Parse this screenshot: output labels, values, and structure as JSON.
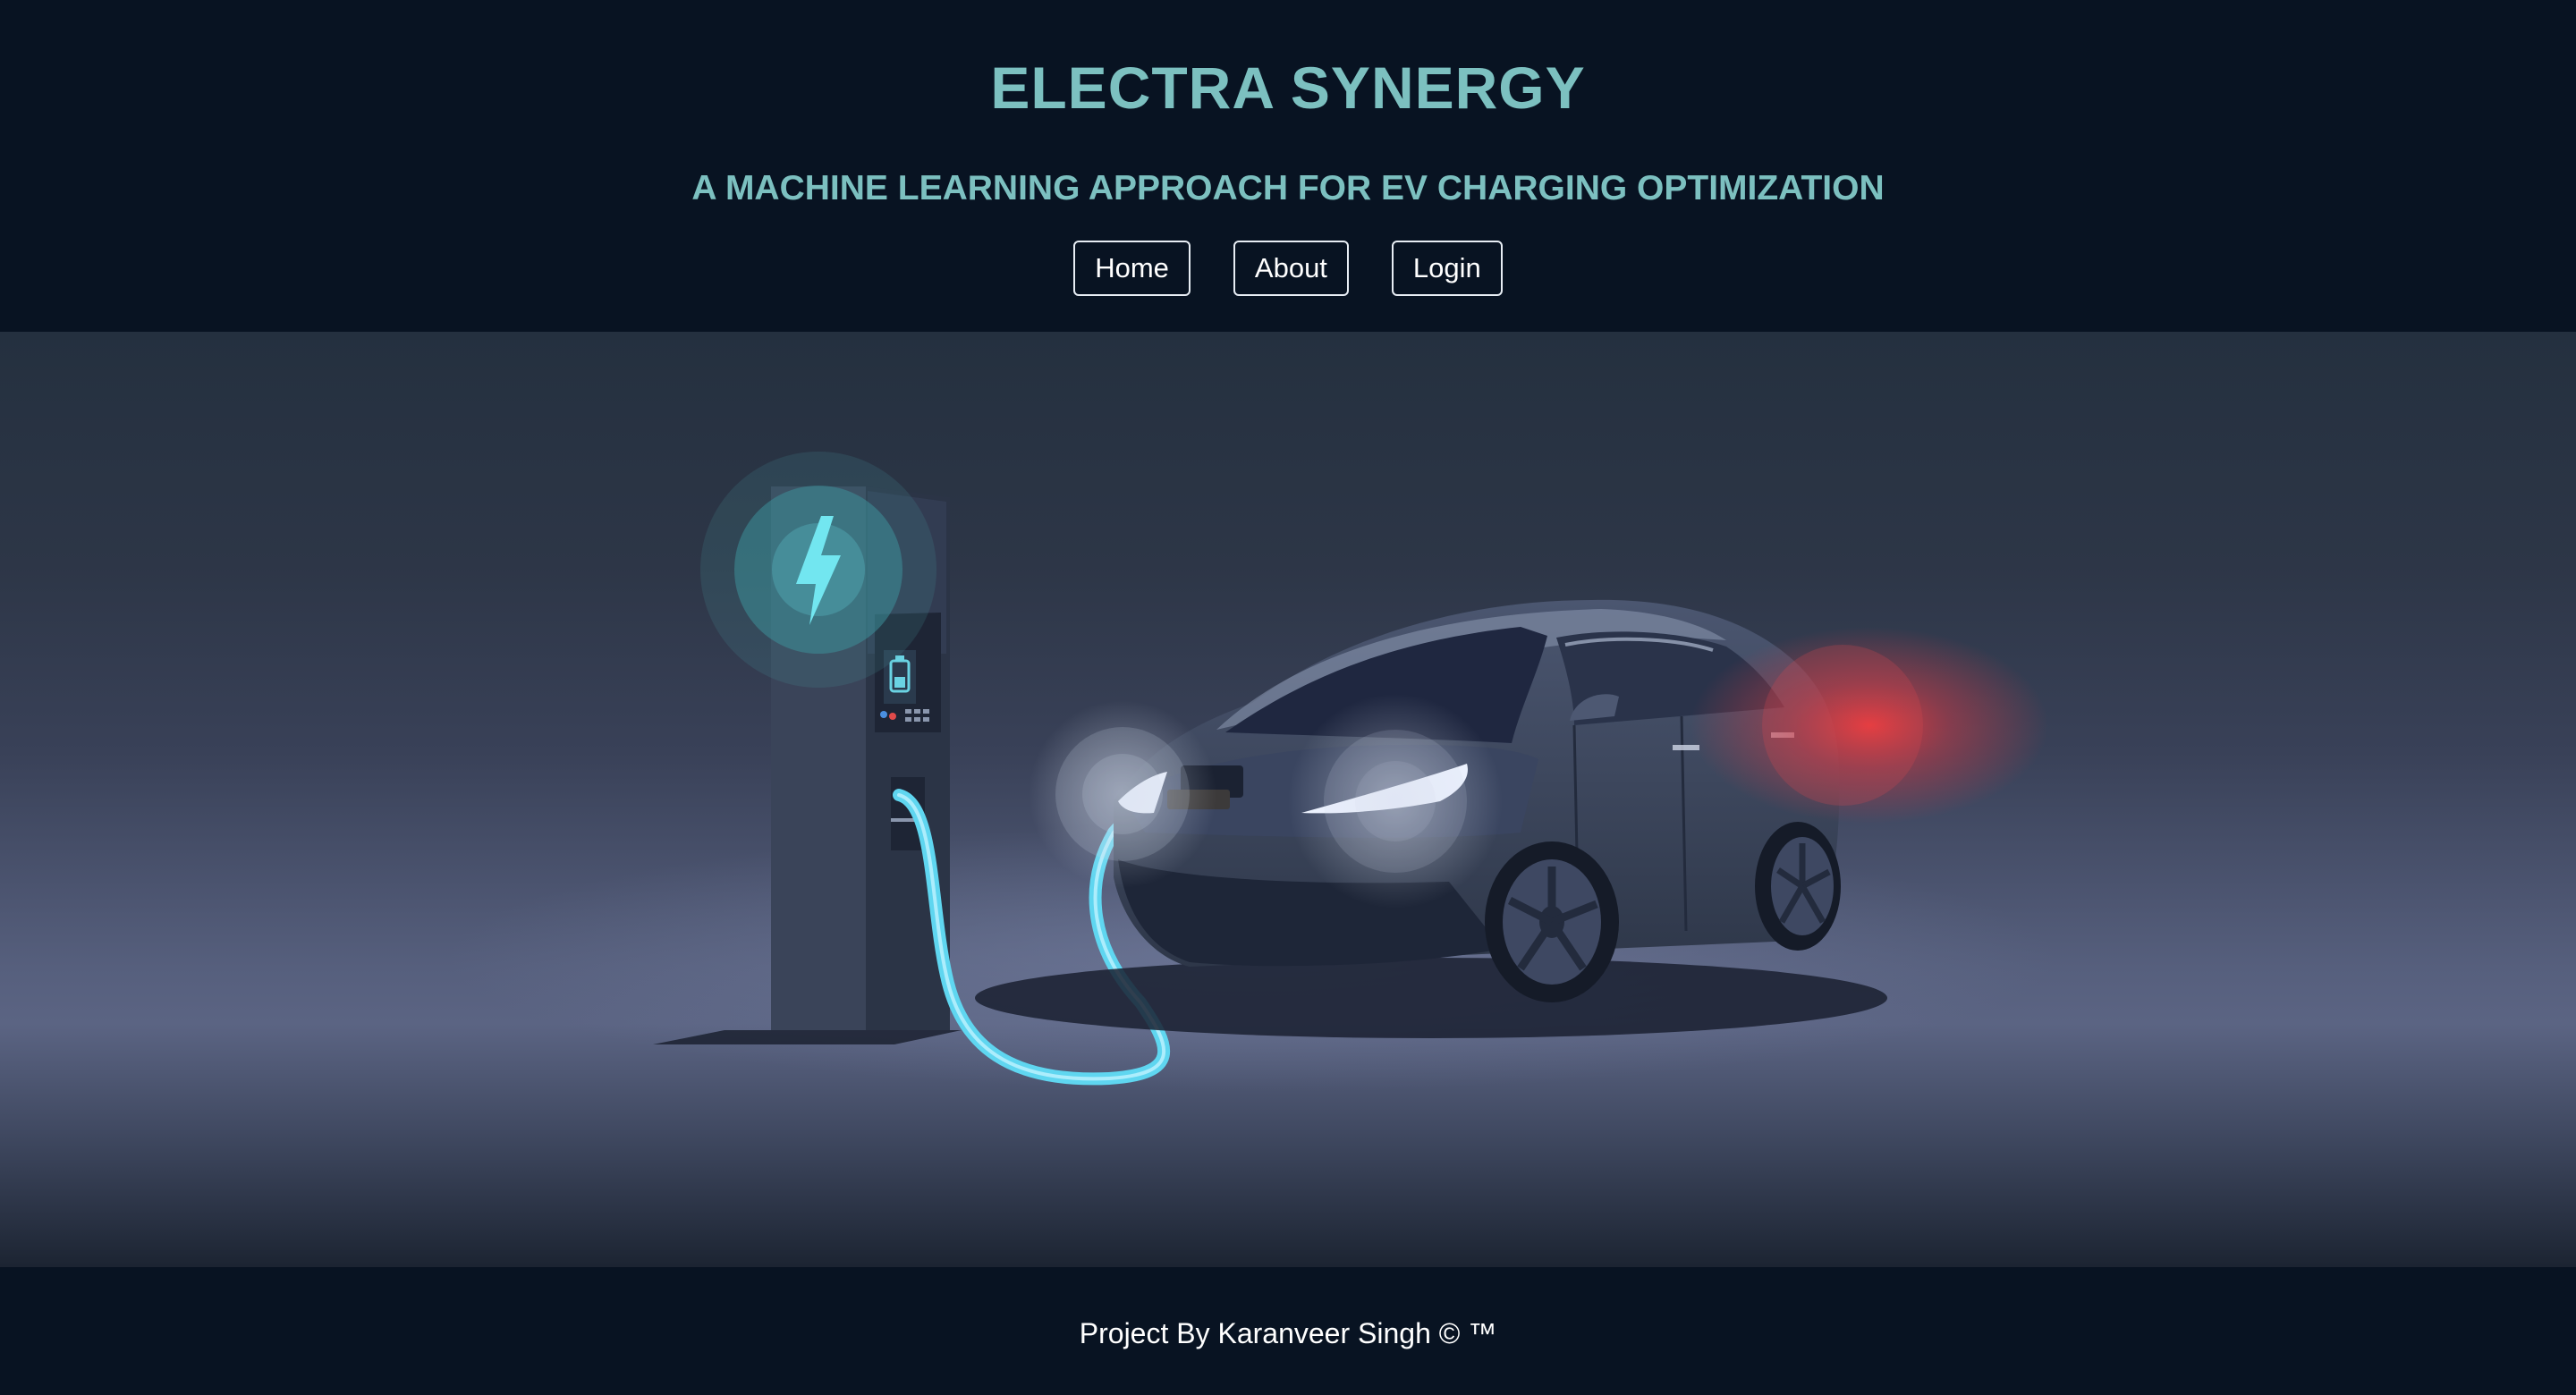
{
  "header": {
    "title": "ELECTRA SYNERGY",
    "subtitle": "A MACHINE LEARNING APPROACH FOR EV CHARGING OPTIMIZATION"
  },
  "nav": {
    "items": [
      {
        "label": "Home"
      },
      {
        "label": "About"
      },
      {
        "label": "Login"
      }
    ]
  },
  "hero": {
    "illustration": "electric car charging at charging station",
    "icons": [
      "lightning-bolt-icon",
      "battery-icon"
    ]
  },
  "footer": {
    "text": "Project By Karanveer Singh © ™"
  },
  "colors": {
    "header_bg": "#081322",
    "accent_teal": "#7cc0c0",
    "cable_glow": "#5fd6f0",
    "tail_light": "#e03a3a"
  }
}
